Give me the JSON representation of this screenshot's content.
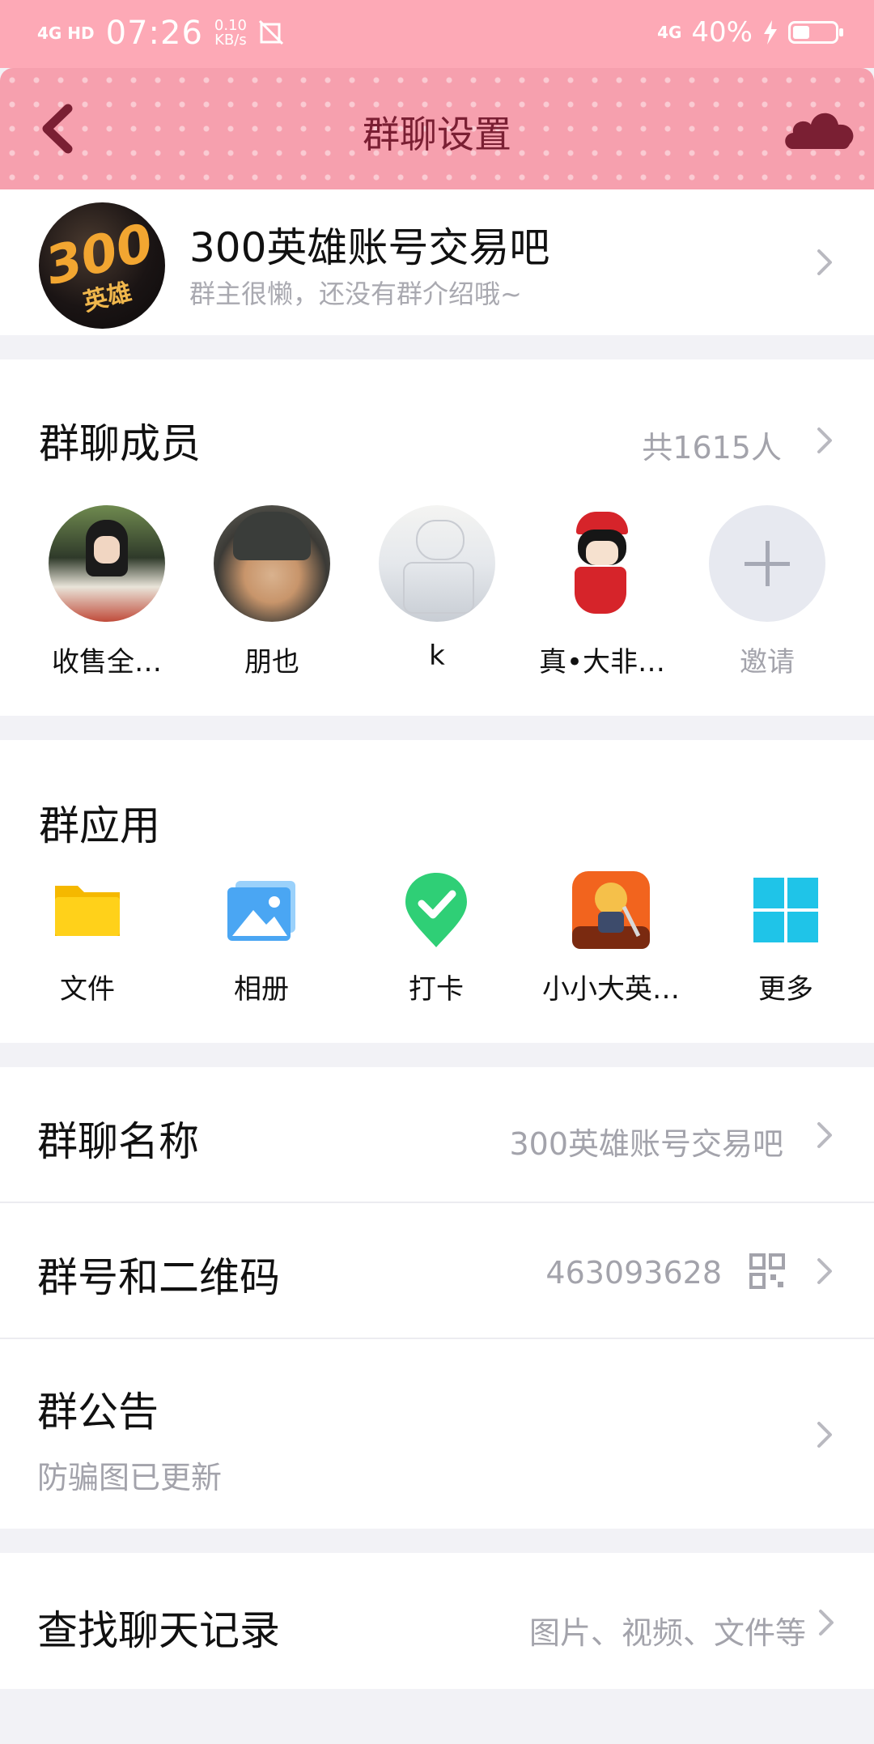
{
  "status_bar": {
    "network": "4G HD",
    "time": "07:26",
    "speed_value": "0.10",
    "speed_unit": "KB/s",
    "network_right": "4G",
    "battery_percent": "40%",
    "battery_level": 0.4
  },
  "header": {
    "title": "群聊设置",
    "back_icon": "chevron-left-icon",
    "cloud_icon": "cloud-icon",
    "accent": "#f6a0ae",
    "title_color": "#7a1f33"
  },
  "group": {
    "avatar_text": "300",
    "avatar_sub": "英雄",
    "name": "300英雄账号交易吧",
    "description": "群主很懒，还没有群介绍哦~"
  },
  "members": {
    "title": "群聊成员",
    "count": "共1615人",
    "list": [
      {
        "name": "收售全…"
      },
      {
        "name": "朋也"
      },
      {
        "name": "k"
      },
      {
        "name": "真•大非…"
      }
    ],
    "invite_label": "邀请"
  },
  "apps": {
    "title": "群应用",
    "items": [
      {
        "label": "文件",
        "icon": "folder-icon"
      },
      {
        "label": "相册",
        "icon": "photo-album-icon"
      },
      {
        "label": "打卡",
        "icon": "check-in-icon"
      },
      {
        "label": "小小大英…",
        "icon": "game-icon"
      },
      {
        "label": "更多",
        "icon": "grid-more-icon"
      }
    ]
  },
  "settings": {
    "group_name_label": "群聊名称",
    "group_name_value": "300英雄账号交易吧",
    "group_number_label": "群号和二维码",
    "group_number_value": "463093628",
    "announcement_label": "群公告",
    "announcement_value": "防骗图已更新",
    "search_label": "查找聊天记录",
    "search_value": "图片、视频、文件等"
  }
}
